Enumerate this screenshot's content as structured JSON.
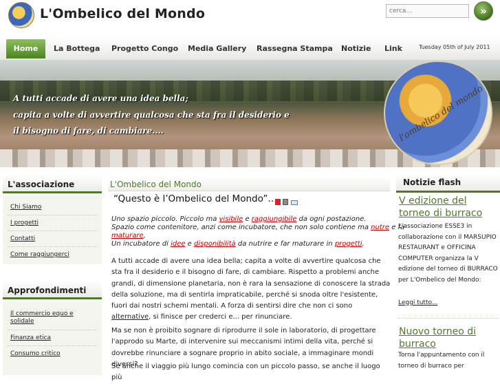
{
  "site": {
    "title": "L'Ombelico del Mondo",
    "search_placeholder": "cerca...",
    "search_button_label": "»"
  },
  "nav": {
    "items": [
      "Home",
      "La Bottega",
      "Progetto Congo",
      "Media Gallery",
      "Rassegna Stampa",
      "Notizie",
      "Link"
    ],
    "active": "Home",
    "date": "Tuesday 05th of July 2011"
  },
  "banner": {
    "lines": [
      "A tutti accade di avere una  idea bella;",
      "capita a volte di avvertire qualcosa che sta fra il desiderio e",
      "il bisogno di fare, di cambiare...."
    ],
    "logo_text": "l'ombelico del mondo"
  },
  "sidebar": {
    "association": {
      "title": "L'associazione",
      "links": [
        "Chi Siamo",
        "I progetti",
        "Contatti",
        "Come raggiungerci"
      ]
    },
    "insights": {
      "title": "Approfondimenti",
      "links": [
        [
          "Il commercio equo e",
          "solidale"
        ],
        [
          "Finanza etica"
        ],
        [
          "Consumo critico"
        ]
      ]
    }
  },
  "main": {
    "section_title": "L'Ombelico del Mondo",
    "article_title": "“Questo è l’Ombelico del Mondo”…",
    "intro": [
      {
        "parts": [
          "Uno spazio piccolo. Piccolo ma ",
          "visibile",
          " e ",
          "raggiungibile",
          " da ogni postazione."
        ]
      },
      {
        "parts": [
          "Spazio come contenitore, anzi come incubatore, che non solo contiene ma ",
          "nutre",
          " e fa"
        ]
      },
      {
        "parts": [
          "maturare",
          ","
        ]
      },
      {
        "parts": [
          "Un incubatore di ",
          "idee",
          " e ",
          "disponibilità",
          "  da nutrire e far maturare in ",
          "progetti",
          "."
        ]
      }
    ],
    "paragraph1": [
      "A tutti accade di avere una  idea bella; capita a volte di avvertire qualcosa che sta fra il desiderio e il bisogno di fare, di cambiare. Rispetto a problemi anche grandi, di dimensione planetaria, non è rara la sensazione  di conoscere la strada  della soluzione, ma di sentirla impraticabile, perché si snoda oltre l'esistente, fuori dai nostri schemi mentali. A forza di sentirsi dire che non ci sono ",
      "alternative",
      ", si finisce per crederci e... per rinunciare."
    ],
    "paragraph2": "Ma se non è proibito sognare di riprodurre il sole in laboratorio, di progettare l'approdo su Marte, di intervenire sui meccanismi intimi della vita, perché si dovrebbe rinunciare a sognare proprio in abito sociale, a immaginare mondi diversi?",
    "paragraph3": "Se anche il viaggio più lungo comincia con un piccolo passo, se anche il luogo più"
  },
  "news": {
    "title": "Notizie flash",
    "items": [
      {
        "title": "V edizione del torneo di burraco",
        "body": "L'associazione ESSE3 in collaborazione con il MARSUPIO RESTAURANT e OFFICINA COMPUTER organizza la V edizione del torneo di BURRACO per L'Ombelico del Mondo:",
        "more": "Leggi tutto..."
      },
      {
        "title": "Nuovo torneo di burraco",
        "body": "Torna l'appuntamento con il torneo di burraco per"
      }
    ]
  }
}
